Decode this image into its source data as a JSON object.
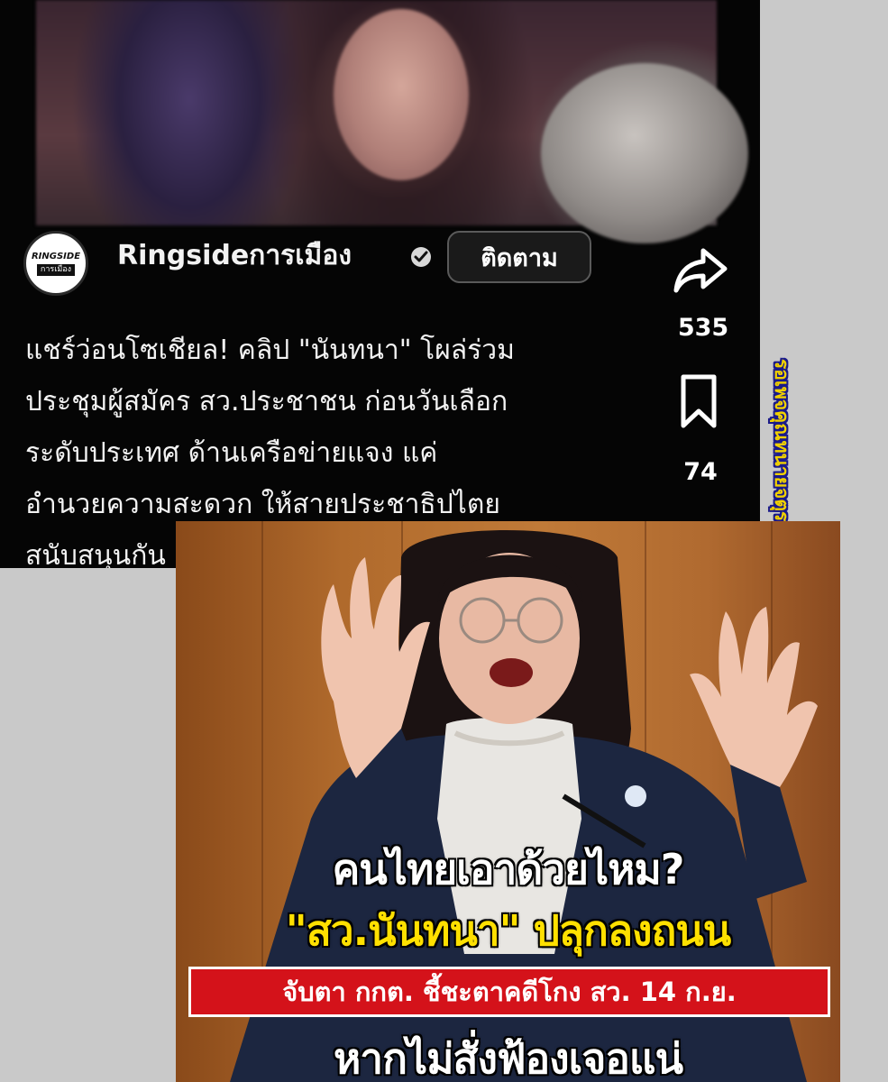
{
  "post": {
    "channel_name": "Ringsideการเมือง",
    "avatar_logo_top": "RINGSIDE",
    "avatar_logo_bottom": "การเมือง",
    "follow_label": "ติดตาม",
    "caption_lines": [
      "แชร์ว่อนโซเชียล! คลิป \"นันทนา\" โผล่ร่วม",
      "ประชุมผู้สมัคร สว.ประชาชน ก่อนวันเลือก",
      "ระดับประเทศ ด้านเครือข่ายแจง แค่",
      "อำนวยความสะดวก ให้สายประชาธิปไตย",
      "สนับสนุนกัน"
    ],
    "share_count": "535",
    "bookmark_count": "74"
  },
  "watermark": "รอเพจคุณทนายจตุรงค์กับนาย",
  "news": {
    "headline_1": "คนไทยเอาด้วยไหม?",
    "headline_2": "\"สว.นันทนา\" ปลุกลงถนน",
    "banner": "จับตา กกต. ชี้ชะตาคดีโกง สว. 14 ก.ย.",
    "headline_3": "หากไม่สั่งฟ้องเจอแน่"
  },
  "icons": {
    "share": "share-arrow-icon",
    "bookmark": "bookmark-icon",
    "more": "more-dots-icon",
    "verified": "verified-badge-icon"
  },
  "colors": {
    "banner_red": "#d4121a",
    "headline_yellow": "#ffe000",
    "watermark_yellow": "#f0d000",
    "watermark_outline": "#1a1a8a"
  }
}
